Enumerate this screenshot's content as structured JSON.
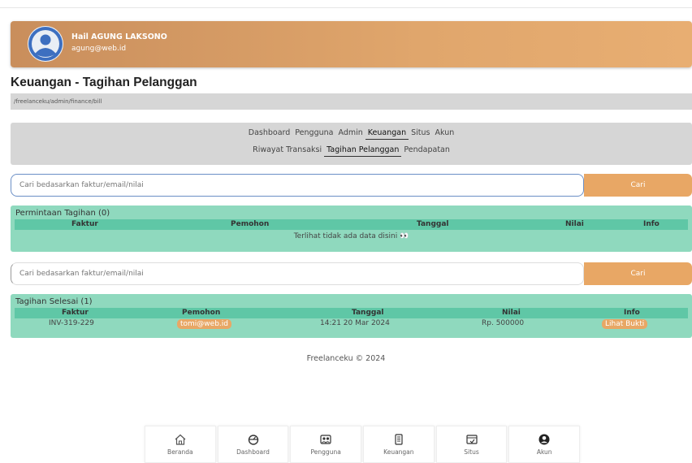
{
  "header": {
    "greeting": "Hail AGUNG LAKSONO",
    "email": "agung@web.id"
  },
  "page": {
    "title": "Keuangan - Tagihan Pelanggan",
    "breadcrumb": "/freelanceku/admin/finance/bill"
  },
  "nav": {
    "primary": [
      "Dashboard",
      "Pengguna",
      "Admin",
      "Keuangan",
      "Situs",
      "Akun"
    ],
    "primary_active": "Keuangan",
    "secondary": [
      "Riwayat Transaksi",
      "Tagihan Pelanggan",
      "Pendapatan"
    ],
    "secondary_active": "Tagihan Pelanggan"
  },
  "search1": {
    "placeholder": "Cari bedasarkan faktur/email/nilai",
    "button": "Cari"
  },
  "requests": {
    "title": "Permintaan Tagihan (0)",
    "columns": [
      "Faktur",
      "Pemohon",
      "Tanggal",
      "Nilai",
      "Info"
    ],
    "empty": "Terlihat tidak ada data disini 👀"
  },
  "search2": {
    "placeholder": "Cari bedasarkan faktur/email/nilai",
    "button": "Cari"
  },
  "done": {
    "title": "Tagihan Selesai (1)",
    "columns": [
      "Faktur",
      "Pemohon",
      "Tanggal",
      "Nilai",
      "Info"
    ],
    "rows": [
      {
        "faktur": "INV-319-229",
        "pemohon": "tomi@web.id",
        "tanggal": "14:21 20 Mar 2024",
        "nilai": "Rp. 500000",
        "info": "Lihat Bukti"
      }
    ]
  },
  "footer": "Freelanceku © 2024",
  "bottom_nav": [
    {
      "label": "Beranda",
      "icon": "home-icon"
    },
    {
      "label": "Dashboard",
      "icon": "dashboard-icon"
    },
    {
      "label": "Pengguna",
      "icon": "users-icon"
    },
    {
      "label": "Keuangan",
      "icon": "finance-icon"
    },
    {
      "label": "Situs",
      "icon": "site-icon"
    },
    {
      "label": "Akun",
      "icon": "account-icon"
    }
  ],
  "colors": {
    "header_gradient_start": "#c98e5c",
    "header_gradient_end": "#e8ae72",
    "accent_orange": "#e8a765",
    "panel_green": "#8fd9be",
    "table_header_green": "#5fc7a6"
  }
}
